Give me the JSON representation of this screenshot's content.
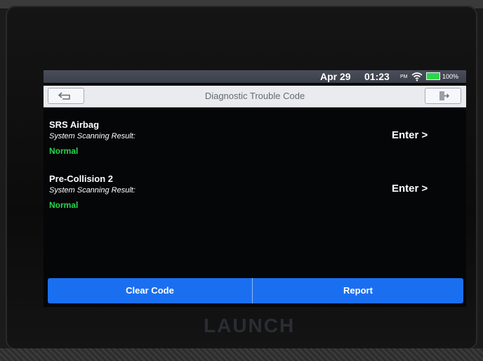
{
  "status_bar": {
    "date": "Apr 29",
    "time": "01:23",
    "ampm": "PM",
    "battery": "100%"
  },
  "header": {
    "title": "Diagnostic Trouble Code"
  },
  "systems": [
    {
      "name": "SRS Airbag",
      "label": "System Scanning Result:",
      "status": "Normal",
      "action": "Enter >"
    },
    {
      "name": "Pre-Collision 2",
      "label": "System Scanning Result:",
      "status": "Normal",
      "action": "Enter >"
    }
  ],
  "footer": {
    "clear_code": "Clear Code",
    "report": "Report"
  },
  "device": {
    "brand": "LAUNCH"
  },
  "colors": {
    "accent": "#1a6ff0",
    "status_ok": "#27d64c"
  },
  "icons": {
    "back": "back-arrow-icon",
    "exit": "exit-door-icon",
    "wifi": "wifi-icon",
    "battery": "battery-icon"
  }
}
